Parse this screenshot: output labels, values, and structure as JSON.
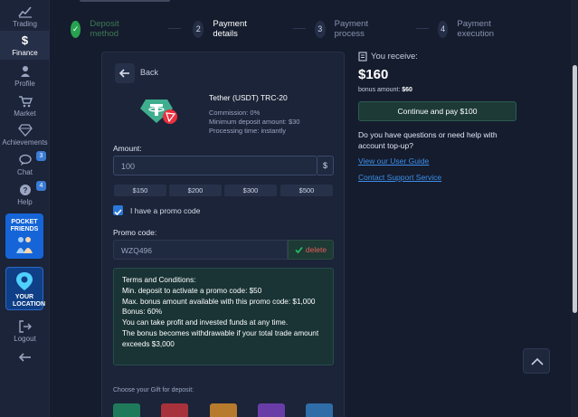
{
  "sidebar": {
    "items": [
      {
        "label": "Trading",
        "icon": "chart-icon"
      },
      {
        "label": "Finance",
        "icon": "dollar-icon"
      },
      {
        "label": "Profile",
        "icon": "user-icon"
      },
      {
        "label": "Market",
        "icon": "cart-icon"
      },
      {
        "label": "Achievements",
        "icon": "diamond-icon"
      },
      {
        "label": "Chat",
        "icon": "chat-icon",
        "badge": "3"
      },
      {
        "label": "Help",
        "icon": "help-icon",
        "badge": "4"
      }
    ],
    "promo_friends": "POCKET FRIENDS",
    "promo_location": "YOUR LOCATION",
    "logout_label": "Logout"
  },
  "stepper": {
    "steps": [
      {
        "num": "✓",
        "label": "Deposit method"
      },
      {
        "num": "2",
        "label": "Payment details"
      },
      {
        "num": "3",
        "label": "Payment process"
      },
      {
        "num": "4",
        "label": "Payment execution"
      }
    ]
  },
  "panel": {
    "back_label": "Back",
    "method": {
      "name": "Tether (USDT) TRC-20",
      "commission": "Commission: 0%",
      "min_deposit": "Minimum deposit amount: $30",
      "processing": "Processing time: instantly"
    },
    "amount_label": "Amount:",
    "amount_value": "100",
    "currency_symbol": "$",
    "quick_amounts": [
      "$150",
      "$200",
      "$300",
      "$500"
    ],
    "promo_checkbox_label": "I have a promo code",
    "promo_label": "Promo code:",
    "promo_value": "WZQ496",
    "delete_label": "delete",
    "terms": [
      "Terms and Conditions:",
      "Min. deposit to activate a promo code: $50",
      "Max. bonus amount available with this promo code: $1,000",
      "Bonus: 60%",
      "You can take profit and invested funds at any time.",
      "The bonus becomes withdrawable if your total trade amount exceeds $3,000"
    ],
    "gift_label": "Choose your Gift for deposit:",
    "gift_colors": [
      "#1f7a5c",
      "#a8323c",
      "#b87a2c",
      "#6a3ca8",
      "#2f6da8"
    ]
  },
  "summary": {
    "receive_label": "You receive:",
    "receive_amount": "$160",
    "bonus_prefix": "bonus amount: ",
    "bonus_amount": "$60",
    "pay_button": "Continue and pay $100",
    "help_text": "Do you have questions or need help with account top-up?",
    "user_guide_link": "View our User Guide",
    "support_link": "Contact Support Service"
  }
}
